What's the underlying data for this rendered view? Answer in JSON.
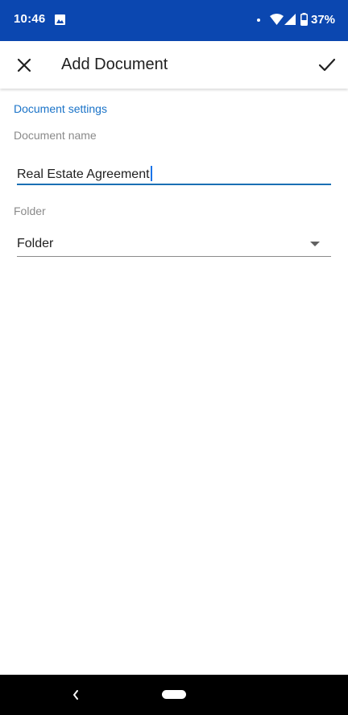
{
  "status_bar": {
    "time": "10:46",
    "battery": "37%",
    "background_color": "#0b47b0",
    "icons": [
      "image-icon",
      "notification-dot",
      "wifi-icon",
      "signal-icon",
      "battery-icon"
    ]
  },
  "app_bar": {
    "title": "Add Document",
    "close_icon": "close-icon",
    "confirm_icon": "check-icon"
  },
  "form": {
    "section_header": "Document settings",
    "document_name": {
      "label": "Document name",
      "value": "Real Estate Agreement"
    },
    "folder": {
      "label": "Folder",
      "selected": "Folder"
    }
  },
  "nav_bar": {
    "icons": [
      "back-icon",
      "home-pill"
    ]
  },
  "colors": {
    "accent": "#1a73c8",
    "status_bar": "#0b47b0"
  }
}
